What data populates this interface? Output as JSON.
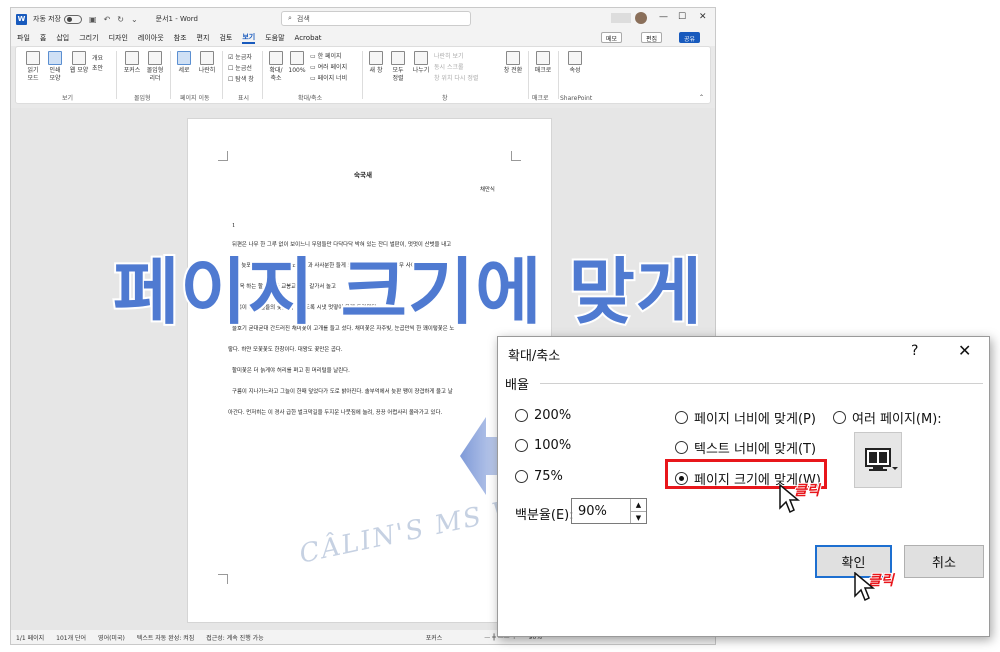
{
  "word": {
    "titlebar": {
      "autosave_label": "자동 저장",
      "doc_title": "문서1  -  Word",
      "search_placeholder": "검색",
      "minimize": "—",
      "restore": "☐",
      "close": "✕"
    },
    "menu": [
      "파일",
      "홈",
      "삽입",
      "그리기",
      "디자인",
      "레이아웃",
      "참조",
      "편지",
      "검토",
      "보기",
      "도움말",
      "Acrobat"
    ],
    "active_menu_index": 9,
    "top_buttons": {
      "memo": "메모",
      "edit": "편집",
      "share": "공유"
    },
    "ribbon": {
      "read_mode": "읽기\n모드",
      "print_layout": "인쇄\n모양",
      "web_layout": "웹 모양",
      "outline": "개요",
      "draft": "초안",
      "group_views": "보기",
      "focus": "포커스",
      "immersive_reader": "몰입형\n리더",
      "group_immersive": "몰입형",
      "vertical": "세로",
      "side_by_side": "나란히",
      "group_page_movement": "페이지 이동",
      "ruler": "눈금자",
      "gridlines": "눈금선",
      "nav_pane": "탐색 창",
      "group_show": "표시",
      "zoom": "확대/\n축소",
      "zoom_100": "100%",
      "one_page": "한 페이지",
      "multiple_pages": "여러 페이지",
      "page_width": "페이지 너비",
      "group_zoom": "확대/축소",
      "new_window": "새 창",
      "arrange_all": "모두\n정렬",
      "split": "나누기",
      "view_side_by_side": "나란히 보기",
      "sync_scroll": "동시 스크롤",
      "reset_window": "창 위치 다시 정렬",
      "switch_windows": "창 전환",
      "group_window": "창",
      "macros": "매크로",
      "group_macros": "매크로",
      "properties": "속성",
      "group_sharepoint": "SharePoint"
    },
    "document": {
      "title": "숙국새",
      "author": "채만식",
      "section": "1",
      "lines": [
        "뒤편은 나무 한 그루 없이 보이느니 무덤들만 다닥다닥 박혀 있는 잔디 벌판이, 멋멋이 산벗을 내고",
        "솔다. 늦포지 않는 뜨락편은 노란 꽃과 사사분한 들게 뜨려진 새 자그는 참 나무 사이로 신비한",
        "이 그윽 하는 할 소로가 교봉교봉 완 갈가서 놀고",
        "소복이 사뿐 길들의 꽃술도, 빛나도록 시냇 멋떻이 윤게 드리웠다.",
        "물호기 굳대굳대 간드러진 채미꽃이 고개를 들고 섰다. 채미꽃은 자주빛, 눈곱만씩 한 꽤이렇꽃은 노",
        "랗다. 하얀 모꽃꽃도 한창이다. 대왕도 꽃만은 곱다.",
        "할미꽃은 더 늙게야 허리를 펴고 흰 머리털을 날린다.",
        "구름이 지나가느라고 그늘이 한때 덮었다가 도로 밝아진다. 솔부억에서 늦판 쨍이 쟝겹하게 울고 날",
        "아간다. 먼저히는 이 경사 급한 벌크막길을 두지운 나뭇짐에 눌려, 끙끙 어렵사리 올라가고 있다."
      ]
    },
    "status": {
      "page": "1/1 페이지",
      "words": "101개 단어",
      "language": "영어(미국)",
      "predictions": "텍스트 자동 완성: 켜짐",
      "accessibility": "접근성: 계속 진행 가능",
      "focus": "포커스",
      "zoom": "90%"
    }
  },
  "overlay_title": "페이지 크기에 맞게",
  "watermark": "CÂLIN'S MS WORD TUTORIALS",
  "dialog": {
    "title": "확대/축소",
    "help": "?",
    "close": "✕",
    "group_label": "배율",
    "options": [
      {
        "label": "200%",
        "selected": false
      },
      {
        "label": "100%",
        "selected": false
      },
      {
        "label": "75%",
        "selected": false
      },
      {
        "label": "페이지 너비에 맞게(P)",
        "selected": false
      },
      {
        "label": "텍스트 너비에 맞게(T)",
        "selected": false
      },
      {
        "label": "페이지 크기에 맞게(W)",
        "selected": true
      },
      {
        "label": "여러 페이지(M):",
        "selected": false
      }
    ],
    "percent_label": "백분율(E):",
    "percent_value": "90%",
    "ok": "확인",
    "cancel": "취소"
  },
  "click_label": "클릭",
  "colors": {
    "word_blue": "#185abd",
    "highlight_red": "#e8161b",
    "title_blue": "#4f7ad1"
  }
}
